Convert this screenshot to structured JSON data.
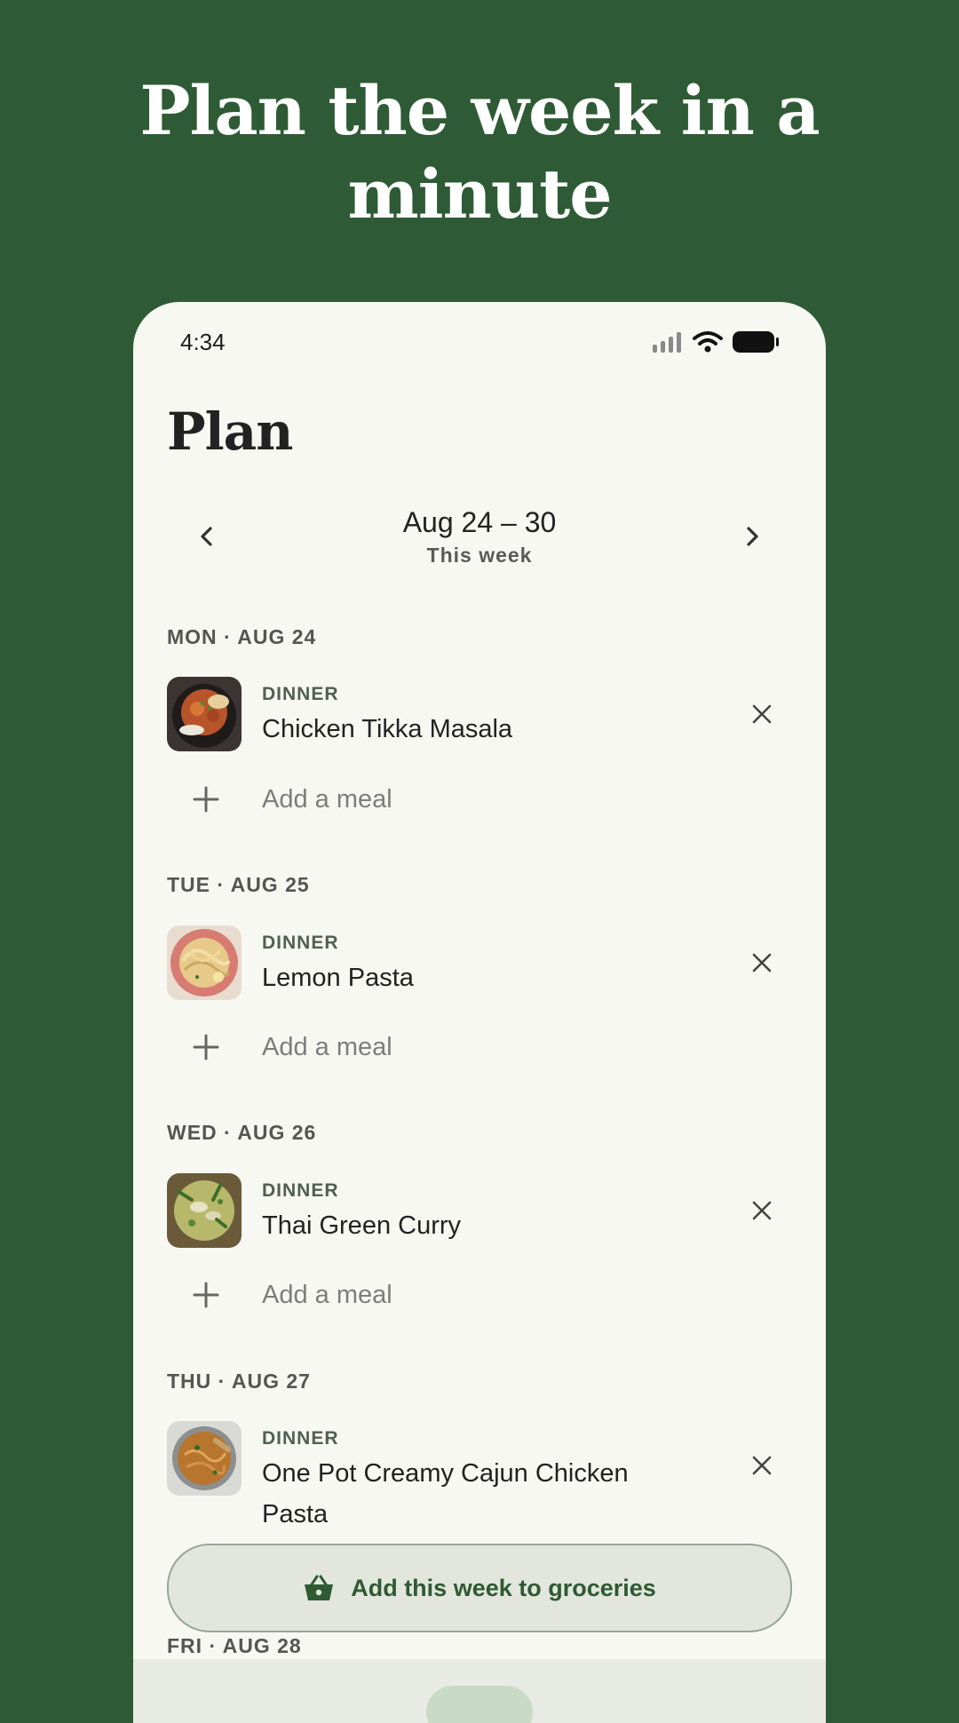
{
  "headline": "Plan the week in a minute",
  "status": {
    "time": "4:34"
  },
  "page_title": "Plan",
  "week": {
    "range": "Aug 24 – 30",
    "label": "This week"
  },
  "days": [
    {
      "header": "MON · AUG 24",
      "meal_type": "DINNER",
      "meal_name": "Chicken Tikka Masala",
      "add_label": "Add a meal"
    },
    {
      "header": "TUE · AUG 25",
      "meal_type": "DINNER",
      "meal_name": "Lemon Pasta",
      "add_label": "Add a meal"
    },
    {
      "header": "WED · AUG 26",
      "meal_type": "DINNER",
      "meal_name": "Thai Green Curry",
      "add_label": "Add a meal"
    },
    {
      "header": "THU · AUG 27",
      "meal_type": "DINNER",
      "meal_name": "One Pot Creamy Cajun Chicken Pasta"
    },
    {
      "header": "FRI · AUG 28"
    }
  ],
  "grocery_button": {
    "label": "Add this week to groceries"
  },
  "colors": {
    "background": "#2e5b35",
    "card": "#f8f8f3",
    "accent": "#2f5a33"
  },
  "icons": [
    "chevron-left-icon",
    "chevron-right-icon",
    "close-icon",
    "plus-icon",
    "basket-icon",
    "wifi-icon",
    "signal-icon",
    "battery-icon"
  ]
}
